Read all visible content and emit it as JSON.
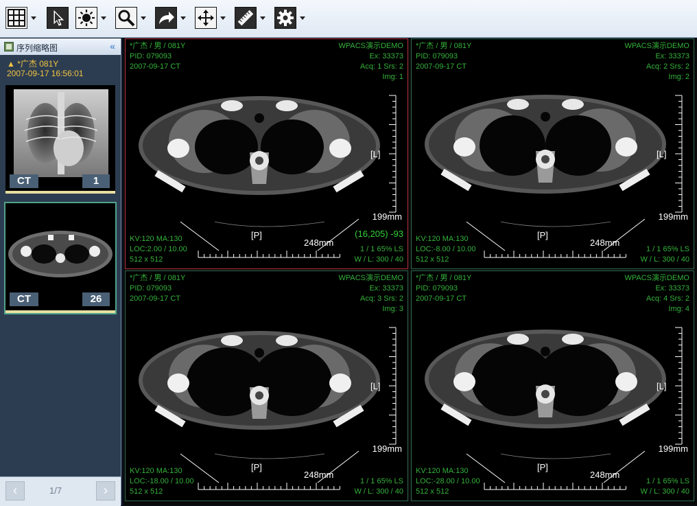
{
  "toolbar": {
    "tools": [
      {
        "icon": "layout-grid-icon"
      },
      {
        "icon": "pointer-icon"
      },
      {
        "icon": "brightness-icon"
      },
      {
        "icon": "zoom-icon"
      },
      {
        "icon": "rotate-arrow-icon"
      },
      {
        "icon": "pan-move-icon"
      },
      {
        "icon": "ruler-icon"
      },
      {
        "icon": "gear-icon"
      }
    ]
  },
  "sidebar": {
    "title": "序列缩略图",
    "collapse": "«",
    "patient": {
      "warning": "▲",
      "name": "*广杰 081Y",
      "datetime": "2007-09-17 16:56:01"
    },
    "thumbs": [
      {
        "modality": "CT",
        "count": "1"
      },
      {
        "modality": "CT",
        "count": "26"
      }
    ],
    "pager": {
      "prev": "‹",
      "page": "1/7",
      "next": "›"
    }
  },
  "viewports": [
    {
      "patient": "*广杰 / 男 / 081Y",
      "pid": "PID: 079093",
      "date": "2007-09-17 CT",
      "org": "WPACS演示DEMO",
      "ex": "Ex: 33373",
      "acq": "Acq: 1 Srs: 2",
      "img": "Img: 1",
      "side": "[L]",
      "post": "[P]",
      "ruler_v": "199mm",
      "ruler_h": "248mm",
      "probe": "(16,205)  -93",
      "kv": "KV:120 MA:130",
      "loc": "LOC:2.00 / 10.00",
      "size": "512 x 512",
      "frame": "1 / 1     65% LS",
      "wl": "W / L:   300 / 40"
    },
    {
      "patient": "*广杰 / 男 / 081Y",
      "pid": "PID: 079093",
      "date": "2007-09-17 CT",
      "org": "WPACS演示DEMO",
      "ex": "Ex: 33373",
      "acq": "Acq: 2 Srs: 2",
      "img": "Img: 2",
      "side": "[L]",
      "post": "[P]",
      "ruler_v": "199mm",
      "ruler_h": "248mm",
      "probe": "",
      "kv": "KV:120 MA:130",
      "loc": "LOC:-8.00 / 10.00",
      "size": "512 x 512",
      "frame": "1 / 1     65% LS",
      "wl": "W / L:   300 / 40"
    },
    {
      "patient": "*广杰 / 男 / 081Y",
      "pid": "PID: 079093",
      "date": "2007-09-17 CT",
      "org": "WPACS演示DEMO",
      "ex": "Ex: 33373",
      "acq": "Acq: 3 Srs: 2",
      "img": "Img: 3",
      "side": "[L]",
      "post": "[P]",
      "ruler_v": "199mm",
      "ruler_h": "248mm",
      "probe": "",
      "kv": "KV:120 MA:130",
      "loc": "LOC:-18.00 / 10.00",
      "size": "512 x 512",
      "frame": "1 / 1     65% LS",
      "wl": "W / L:   300 / 40"
    },
    {
      "patient": "*广杰 / 男 / 081Y",
      "pid": "PID: 079093",
      "date": "2007-09-17 CT",
      "org": "WPACS演示DEMO",
      "ex": "Ex: 33373",
      "acq": "Acq: 4 Srs: 2",
      "img": "Img: 4",
      "side": "[L]",
      "post": "[P]",
      "ruler_v": "199mm",
      "ruler_h": "248mm",
      "probe": "",
      "kv": "KV:120 MA:130",
      "loc": "LOC:-28.00 / 10.00",
      "size": "512 x 512",
      "frame": "1 / 1     65% LS",
      "wl": "W / L:   300 / 40"
    }
  ]
}
